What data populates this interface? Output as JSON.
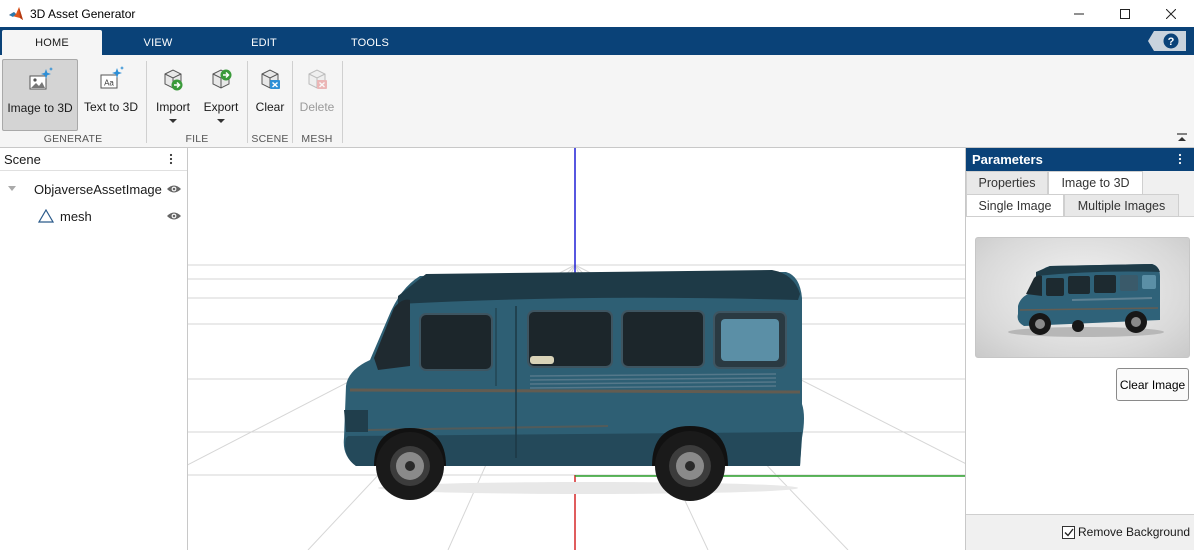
{
  "window": {
    "title": "3D Asset Generator"
  },
  "tabs": [
    {
      "label": "HOME",
      "active": true
    },
    {
      "label": "VIEW",
      "active": false
    },
    {
      "label": "EDIT",
      "active": false
    },
    {
      "label": "TOOLS",
      "active": false
    }
  ],
  "ribbon": {
    "generate": {
      "group_label": "GENERATE",
      "image_to_3d": "Image to 3D",
      "text_to_3d": "Text to 3D"
    },
    "file": {
      "group_label": "FILE",
      "import": "Import",
      "export": "Export"
    },
    "scene": {
      "group_label": "SCENE",
      "clear": "Clear"
    },
    "mesh": {
      "group_label": "MESH",
      "delete": "Delete"
    }
  },
  "scene_panel": {
    "title": "Scene",
    "items": [
      {
        "label": "ObjaverseAssetImage",
        "icon": "caret-down-icon"
      },
      {
        "label": "mesh",
        "icon": "triangle-mesh-icon"
      }
    ]
  },
  "params_panel": {
    "title": "Parameters",
    "tabs": [
      "Properties",
      "Image to 3D"
    ],
    "subtabs": [
      "Single Image",
      "Multiple Images"
    ],
    "clear_image": "Clear Image",
    "remove_background": "Remove Background",
    "remove_background_checked": true
  },
  "colors": {
    "brand": "#0a4278",
    "axis_x": "#d62728",
    "axis_y": "#2ca02c",
    "axis_z": "#1f1fd6",
    "van_body": "#2e5f74"
  }
}
